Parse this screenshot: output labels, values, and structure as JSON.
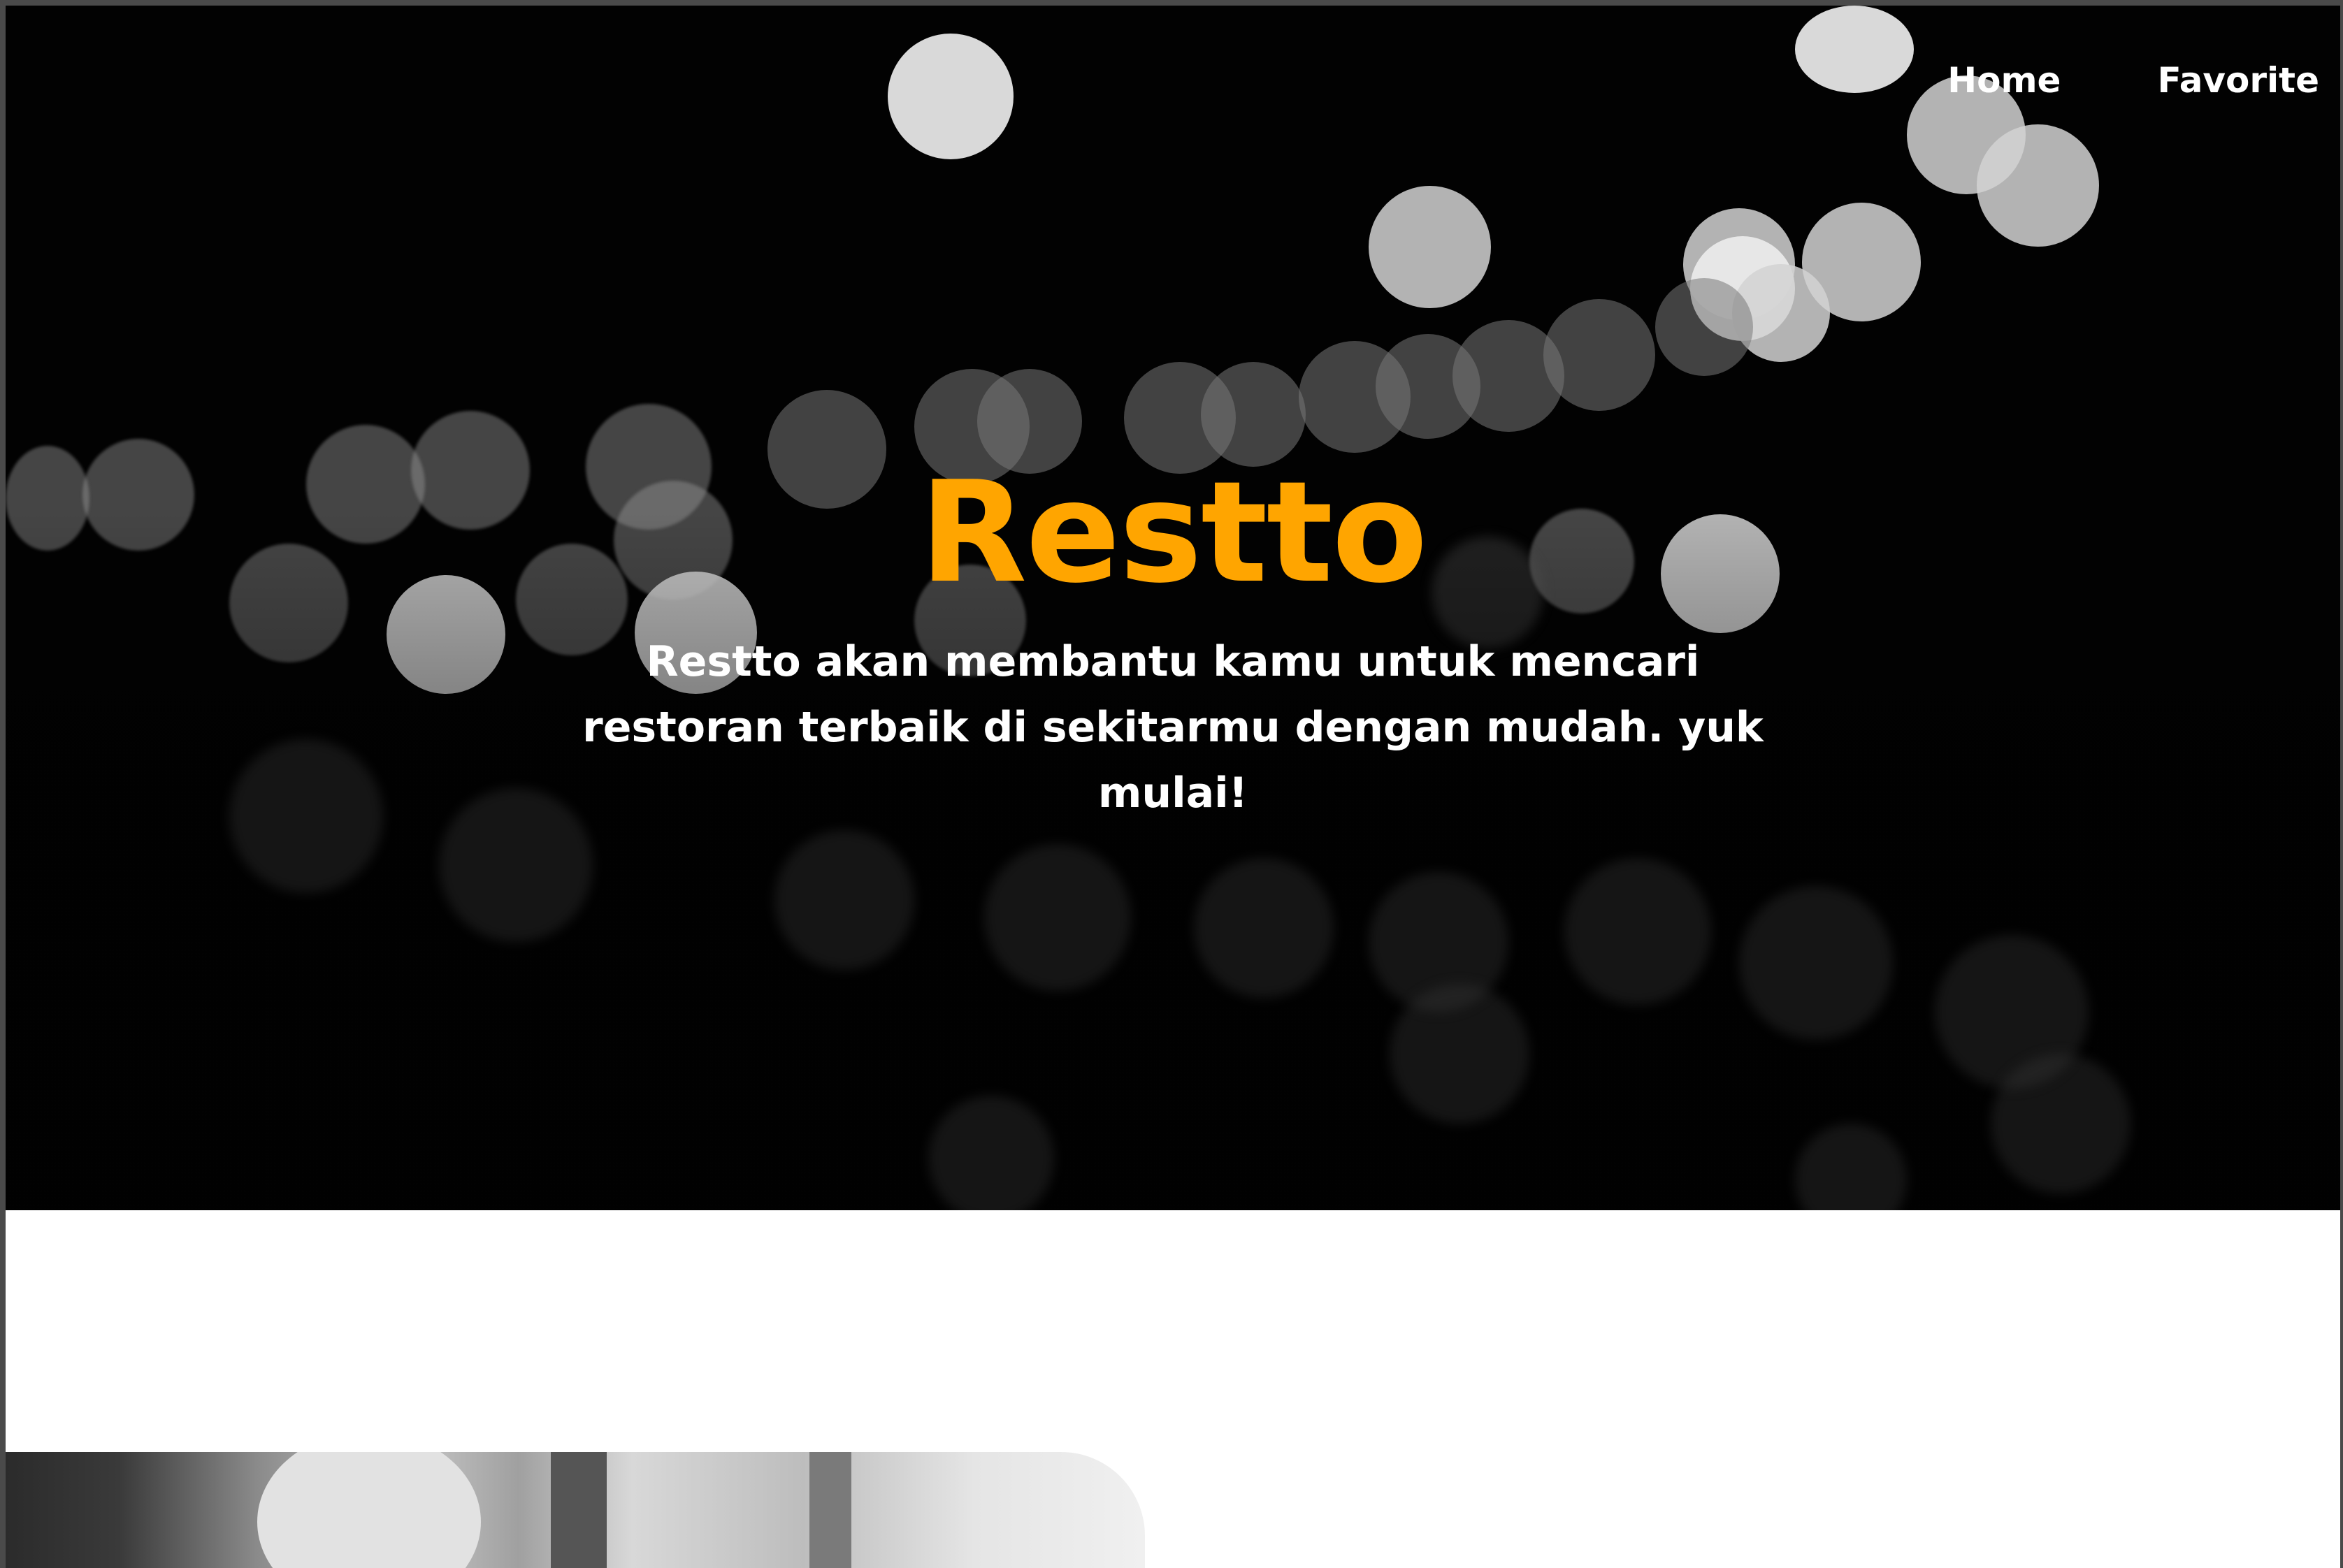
{
  "nav": {
    "items": [
      {
        "label": "Home"
      },
      {
        "label": "Favorite"
      }
    ]
  },
  "hero": {
    "title": "Restto",
    "tagline": "Restto akan membantu kamu untuk mencari restoran terbaik di sekitarmu dengan mudah. yuk mulai!"
  },
  "colors": {
    "accent": "#ffa500",
    "hero_background": "#020202",
    "page_background": "#ffffff",
    "nav_text": "#ffffff"
  }
}
